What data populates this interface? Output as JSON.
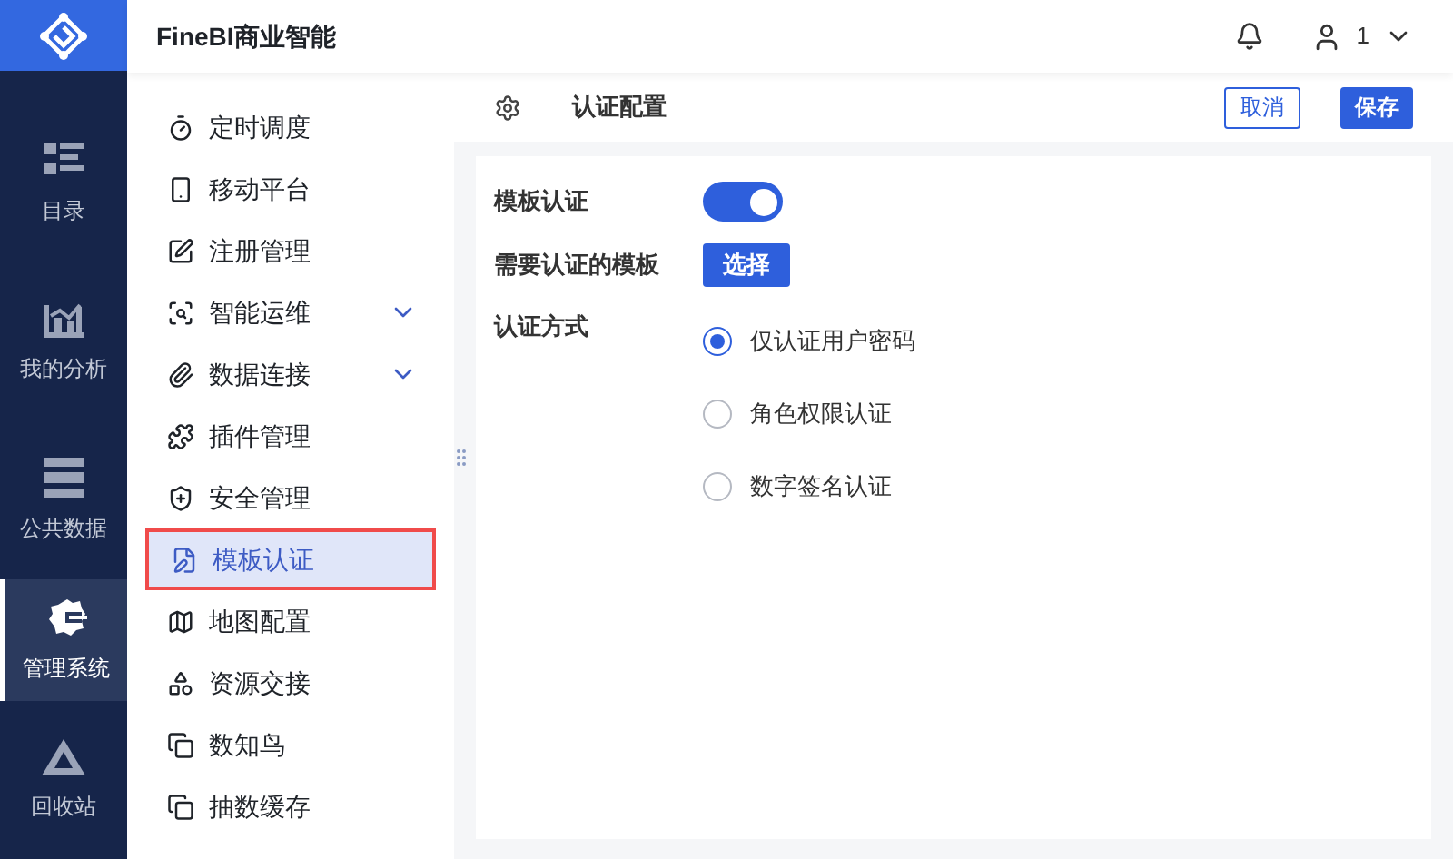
{
  "header": {
    "title": "FineBI商业智能",
    "user": "1"
  },
  "nav": [
    {
      "label": "目录",
      "selected": false
    },
    {
      "label": "我的分析",
      "selected": false
    },
    {
      "label": "公共数据",
      "selected": false
    },
    {
      "label": "管理系统",
      "selected": true
    },
    {
      "label": "回收站",
      "selected": false
    }
  ],
  "menu": [
    {
      "label": "定时调度",
      "selected": false,
      "expandable": false
    },
    {
      "label": "移动平台",
      "selected": false,
      "expandable": false
    },
    {
      "label": "注册管理",
      "selected": false,
      "expandable": false
    },
    {
      "label": "智能运维",
      "selected": false,
      "expandable": true
    },
    {
      "label": "数据连接",
      "selected": false,
      "expandable": true
    },
    {
      "label": "插件管理",
      "selected": false,
      "expandable": false
    },
    {
      "label": "安全管理",
      "selected": false,
      "expandable": false
    },
    {
      "label": "模板认证",
      "selected": true,
      "expandable": false
    },
    {
      "label": "地图配置",
      "selected": false,
      "expandable": false
    },
    {
      "label": "资源交接",
      "selected": false,
      "expandable": false
    },
    {
      "label": "数知鸟",
      "selected": false,
      "expandable": false
    },
    {
      "label": "抽数缓存",
      "selected": false,
      "expandable": false
    }
  ],
  "page": {
    "title": "认证配置",
    "buttons": [
      {
        "label": "取消",
        "kind": "outline"
      },
      {
        "label": "保存",
        "kind": "primary"
      }
    ]
  },
  "form": {
    "toggle": {
      "label": "模板认证",
      "on": true
    },
    "template": {
      "label": "需要认证的模板",
      "button": "选择"
    },
    "method": {
      "label": "认证方式",
      "options": [
        {
          "label": "仅认证用户密码",
          "selected": true
        },
        {
          "label": "角色权限认证",
          "selected": false
        },
        {
          "label": "数字签名认证",
          "selected": false
        }
      ]
    }
  }
}
